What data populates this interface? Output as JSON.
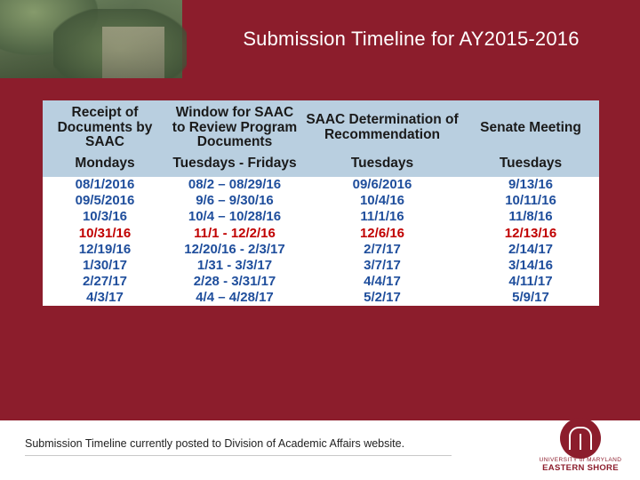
{
  "slide": {
    "title": "Submission Timeline for AY2015-2016",
    "footer_note": "Submission Timeline currently posted to Division of Academic Affairs website.",
    "brand_color": "#8c1d2c",
    "header_cell_color": "#b9cfe0",
    "logo": {
      "line1": "UNIVERSITY of MARYLAND",
      "line2": "EASTERN SHORE"
    }
  },
  "table": {
    "headers": [
      "Receipt of Documents by SAAC",
      "Window for SAAC to Review Program Documents",
      "SAAC Determination of Recommendation",
      "Senate Meeting"
    ],
    "subheaders": [
      "Mondays",
      "Tuesdays - Fridays",
      "Tuesdays",
      "Tuesdays"
    ],
    "rows": [
      {
        "receipt": "08/1/2016",
        "window": "08/2 – 08/29/16",
        "determination": "09/6/2016",
        "senate": "9/13/16",
        "color": "#1f4e9c"
      },
      {
        "receipt": "09/5/2016",
        "window": "9/6 – 9/30/16",
        "determination": "10/4/16",
        "senate": "10/11/16",
        "color": "#1f4e9c"
      },
      {
        "receipt": "10/3/16",
        "window": "10/4 – 10/28/16",
        "determination": "11/1/16",
        "senate": "11/8/16",
        "color": "#1f4e9c"
      },
      {
        "receipt": "10/31/16",
        "window": "11/1 - 12/2/16",
        "determination": "12/6/16",
        "senate": "12/13/16",
        "color": "#c00000"
      },
      {
        "receipt": "12/19/16",
        "window": "12/20/16 - 2/3/17",
        "determination": "2/7/17",
        "senate": "2/14/17",
        "color": "#1f4e9c"
      },
      {
        "receipt": "1/30/17",
        "window": "1/31 - 3/3/17",
        "determination": "3/7/17",
        "senate": "3/14/16",
        "color": "#1f4e9c"
      },
      {
        "receipt": "2/27/17",
        "window": "2/28 - 3/31/17",
        "determination": "4/4/17",
        "senate": "4/11/17",
        "color": "#1f4e9c"
      },
      {
        "receipt": "4/3/17",
        "window": "4/4 – 4/28/17",
        "determination": "5/2/17",
        "senate": "5/9/17",
        "color": "#1f4e9c"
      }
    ]
  }
}
